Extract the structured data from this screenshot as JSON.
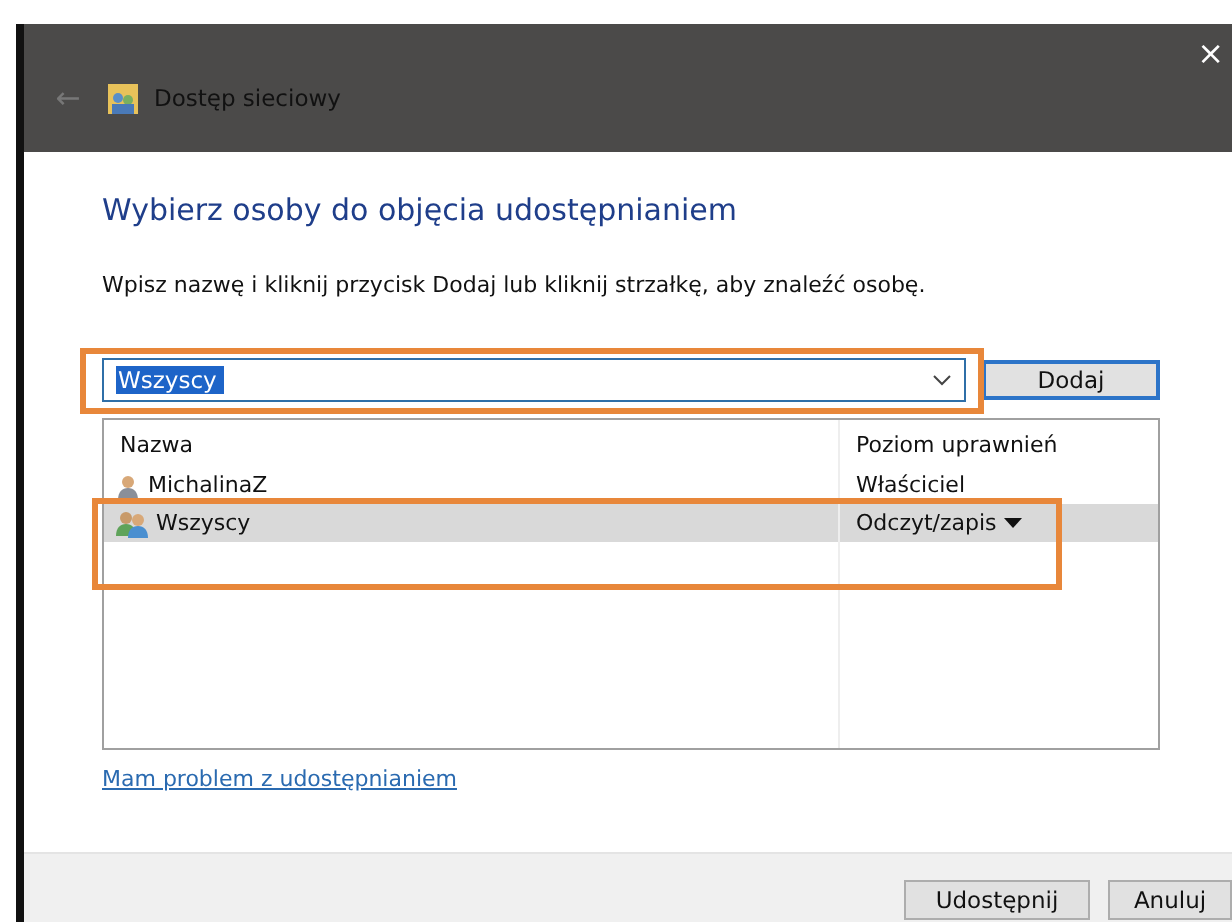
{
  "window": {
    "title": "Dostęp sieciowy",
    "close": "×",
    "back": "←"
  },
  "heading": "Wybierz osoby do objęcia udostępnianiem",
  "instruction": "Wpisz nazwę i kliknij przycisk Dodaj lub kliknij strzałkę, aby znaleźć osobę.",
  "combo": {
    "value": "Wszyscy",
    "highlighted": true
  },
  "add_button": "Dodaj",
  "table": {
    "columns": [
      "Nazwa",
      "Poziom uprawnień"
    ],
    "rows": [
      {
        "kind": "user",
        "name": "MichalinaZ",
        "level": "Właściciel",
        "selected": false,
        "highlighted": false,
        "dropdown": false
      },
      {
        "kind": "group",
        "name": "Wszyscy",
        "level": "Odczyt/zapis",
        "selected": true,
        "highlighted": true,
        "dropdown": true
      }
    ]
  },
  "link": "Mam problem z udostępnianiem",
  "buttons": [
    "Udostępnij",
    "Anuluj"
  ]
}
